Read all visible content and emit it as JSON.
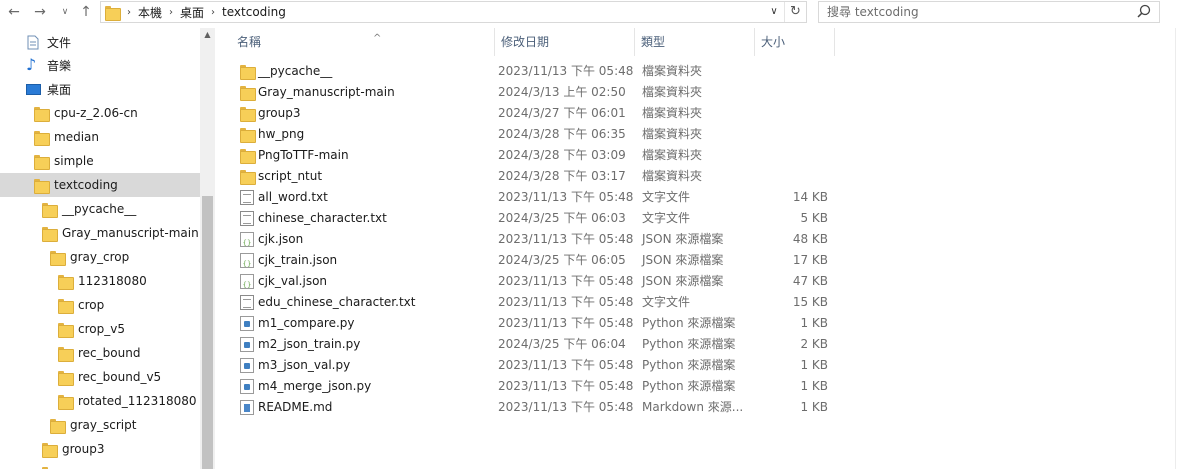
{
  "address": {
    "crumbs": [
      "本機",
      "桌面",
      "textcoding"
    ]
  },
  "search": {
    "placeholder": "搜尋 textcoding"
  },
  "nav": {
    "items": [
      {
        "label": "文件",
        "icon": "document-icon"
      },
      {
        "label": "音樂",
        "icon": "music-icon"
      },
      {
        "label": "桌面",
        "icon": "desktop-icon"
      },
      {
        "label": "cpu-z_2.06-cn",
        "icon": "folder-icon"
      },
      {
        "label": "median",
        "icon": "folder-icon"
      },
      {
        "label": "simple",
        "icon": "folder-icon"
      },
      {
        "label": "textcoding",
        "icon": "folder-icon",
        "selected": true
      },
      {
        "label": "__pycache__",
        "icon": "folder-icon"
      },
      {
        "label": "Gray_manuscript-main",
        "icon": "folder-icon"
      },
      {
        "label": "gray_crop",
        "icon": "folder-icon"
      },
      {
        "label": "112318080",
        "icon": "folder-icon"
      },
      {
        "label": "crop",
        "icon": "folder-icon"
      },
      {
        "label": "crop_v5",
        "icon": "folder-icon"
      },
      {
        "label": "rec_bound",
        "icon": "folder-icon"
      },
      {
        "label": "rec_bound_v5",
        "icon": "folder-icon"
      },
      {
        "label": "rotated_112318080",
        "icon": "folder-icon"
      },
      {
        "label": "gray_script",
        "icon": "folder-icon"
      },
      {
        "label": "group3",
        "icon": "folder-icon"
      }
    ]
  },
  "columns": {
    "name": "名稱",
    "date": "修改日期",
    "type": "類型",
    "size": "大小"
  },
  "files": [
    {
      "name": "__pycache__",
      "date": "2023/11/13 下午 05:48",
      "type": "檔案資料夾",
      "size": "",
      "icon": "folder-icon"
    },
    {
      "name": "Gray_manuscript-main",
      "date": "2024/3/13 上午 02:50",
      "type": "檔案資料夾",
      "size": "",
      "icon": "folder-icon"
    },
    {
      "name": "group3",
      "date": "2024/3/27 下午 06:01",
      "type": "檔案資料夾",
      "size": "",
      "icon": "folder-icon"
    },
    {
      "name": "hw_png",
      "date": "2024/3/28 下午 06:35",
      "type": "檔案資料夾",
      "size": "",
      "icon": "folder-icon"
    },
    {
      "name": "PngToTTF-main",
      "date": "2024/3/28 下午 03:09",
      "type": "檔案資料夾",
      "size": "",
      "icon": "folder-icon"
    },
    {
      "name": "script_ntut",
      "date": "2024/3/28 下午 03:17",
      "type": "檔案資料夾",
      "size": "",
      "icon": "folder-icon"
    },
    {
      "name": "all_word.txt",
      "date": "2023/11/13 下午 05:48",
      "type": "文字文件",
      "size": "14 KB",
      "icon": "text-file-icon"
    },
    {
      "name": "chinese_character.txt",
      "date": "2024/3/25 下午 06:03",
      "type": "文字文件",
      "size": "5 KB",
      "icon": "text-file-icon"
    },
    {
      "name": "cjk.json",
      "date": "2023/11/13 下午 05:48",
      "type": "JSON 來源檔案",
      "size": "48 KB",
      "icon": "json-file-icon"
    },
    {
      "name": "cjk_train.json",
      "date": "2024/3/25 下午 06:05",
      "type": "JSON 來源檔案",
      "size": "17 KB",
      "icon": "json-file-icon"
    },
    {
      "name": "cjk_val.json",
      "date": "2023/11/13 下午 05:48",
      "type": "JSON 來源檔案",
      "size": "47 KB",
      "icon": "json-file-icon"
    },
    {
      "name": "edu_chinese_character.txt",
      "date": "2023/11/13 下午 05:48",
      "type": "文字文件",
      "size": "15 KB",
      "icon": "text-file-icon"
    },
    {
      "name": "m1_compare.py",
      "date": "2023/11/13 下午 05:48",
      "type": "Python 來源檔案",
      "size": "1 KB",
      "icon": "python-file-icon"
    },
    {
      "name": "m2_json_train.py",
      "date": "2024/3/25 下午 06:04",
      "type": "Python 來源檔案",
      "size": "2 KB",
      "icon": "python-file-icon"
    },
    {
      "name": "m3_json_val.py",
      "date": "2023/11/13 下午 05:48",
      "type": "Python 來源檔案",
      "size": "1 KB",
      "icon": "python-file-icon"
    },
    {
      "name": "m4_merge_json.py",
      "date": "2023/11/13 下午 05:48",
      "type": "Python 來源檔案",
      "size": "1 KB",
      "icon": "python-file-icon"
    },
    {
      "name": "README.md",
      "date": "2023/11/13 下午 05:48",
      "type": "Markdown 來源...",
      "size": "1 KB",
      "icon": "markdown-file-icon"
    }
  ]
}
